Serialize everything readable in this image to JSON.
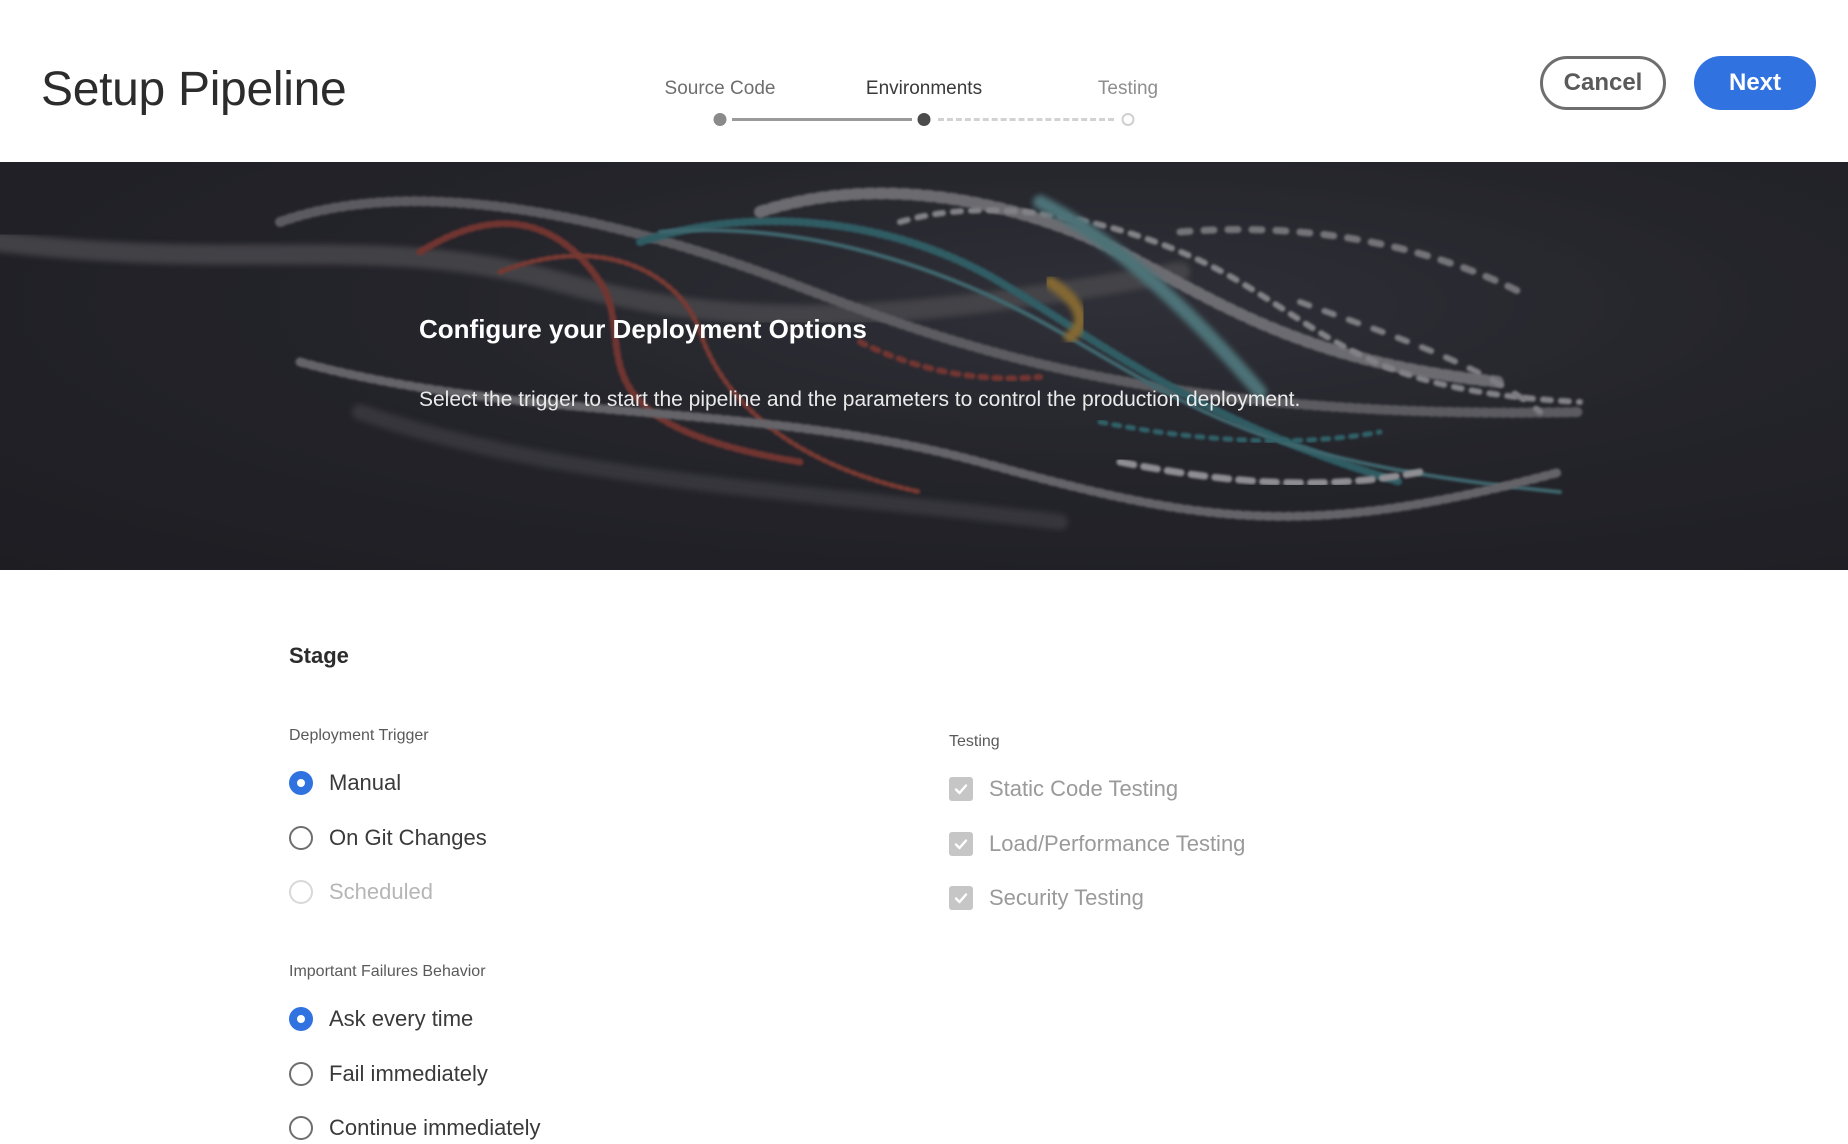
{
  "header": {
    "title": "Setup Pipeline",
    "cancel_label": "Cancel",
    "next_label": "Next"
  },
  "stepper": {
    "steps": [
      {
        "label": "Source Code",
        "status": "completed"
      },
      {
        "label": "Environments",
        "status": "current"
      },
      {
        "label": "Testing",
        "status": "upcoming"
      }
    ]
  },
  "hero": {
    "title": "Configure your Deployment Options",
    "subtitle": "Select the trigger to start the pipeline and the parameters to control the production deployment."
  },
  "stage": {
    "heading": "Stage",
    "deployment_trigger": {
      "label": "Deployment Trigger",
      "options": [
        {
          "label": "Manual",
          "checked": true,
          "disabled": false
        },
        {
          "label": "On Git Changes",
          "checked": false,
          "disabled": false
        },
        {
          "label": "Scheduled",
          "checked": false,
          "disabled": true
        }
      ]
    },
    "failures_behavior": {
      "label": "Important Failures Behavior",
      "options": [
        {
          "label": "Ask every time",
          "checked": true
        },
        {
          "label": "Fail immediately",
          "checked": false
        },
        {
          "label": "Continue immediately",
          "checked": false
        }
      ]
    },
    "testing": {
      "label": "Testing",
      "options": [
        {
          "label": "Static Code Testing",
          "checked": true,
          "disabled": true
        },
        {
          "label": "Load/Performance Testing",
          "checked": true,
          "disabled": true
        },
        {
          "label": "Security Testing",
          "checked": true,
          "disabled": true
        }
      ]
    }
  },
  "colors": {
    "accent": "#2f72e0",
    "hero_background": "#26262c",
    "disabled_checkbox": "#c6c6c6"
  },
  "icons": {
    "checkbox_check": "checkmark-icon"
  }
}
